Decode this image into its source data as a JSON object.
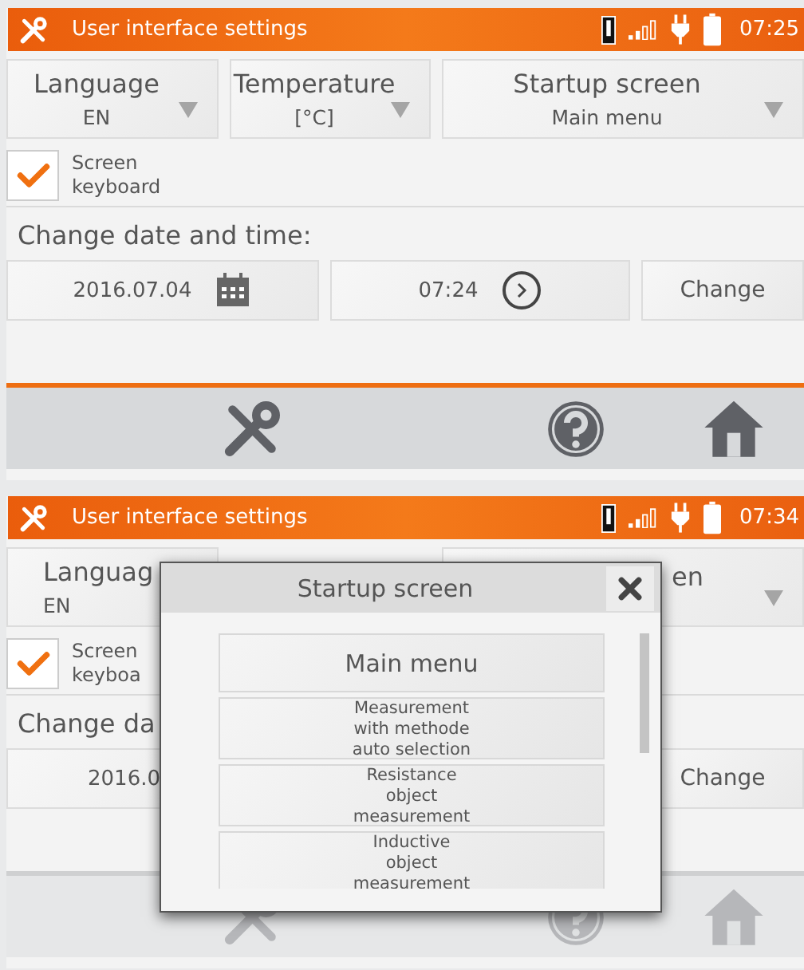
{
  "screens": [
    {
      "status_bar": {
        "title": "User interface settings",
        "time": "07:25"
      },
      "dropdowns": [
        {
          "label": "Language",
          "value": "EN"
        },
        {
          "label": "Temperature",
          "value": "[°C]"
        },
        {
          "label": "Startup screen",
          "value": "Main menu"
        }
      ],
      "checkbox": {
        "label": "Screen keyboard",
        "checked": true
      },
      "section_label": "Change date and time:",
      "date": "2016.07.04",
      "time": "07:24",
      "change_button": "Change"
    },
    {
      "status_bar": {
        "title": "User interface settings",
        "time": "07:34"
      },
      "dropdowns": [
        {
          "label": "Languag",
          "value": "EN"
        },
        {
          "label": "en"
        }
      ],
      "checkbox": {
        "label": "Screen keyboa",
        "checked": true
      },
      "section_label": "Change da",
      "date": "2016.0",
      "change_button": "Change",
      "dialog": {
        "title": "Startup screen",
        "items": [
          {
            "label": "Main menu",
            "kind": "large"
          },
          {
            "label": "Measurement\nwith methode\nauto selection",
            "kind": "small"
          },
          {
            "label": "Resistance\nobject\nmeasurement",
            "kind": "small"
          },
          {
            "label": "Inductive\nobject\nmeasurement",
            "kind": "small"
          }
        ]
      }
    }
  ]
}
